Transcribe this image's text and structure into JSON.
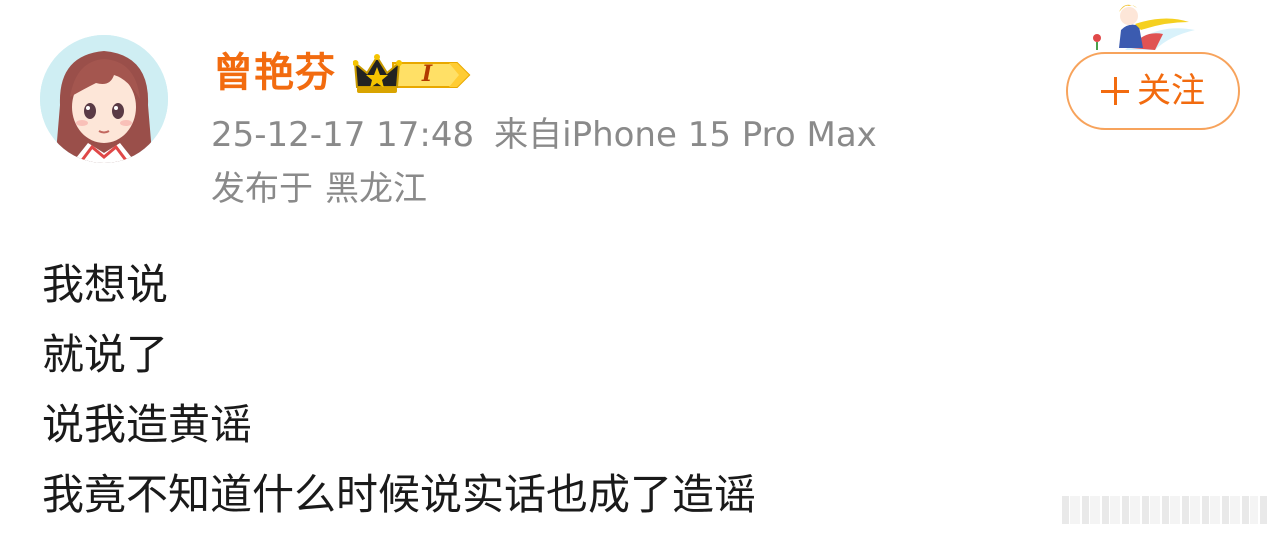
{
  "user": {
    "name": "曾艳芬",
    "vip_level": "I"
  },
  "post_meta": {
    "time": "25-12-17 17:48",
    "source": "来自iPhone 15 Pro Max",
    "location_prefix": "发布于",
    "location": "黑龙江"
  },
  "actions": {
    "follow_label": "关注"
  },
  "content": {
    "lines": [
      "我想说",
      "就说了",
      "说我造黄谣",
      "我竟不知道什么时候说实话也成了造谣"
    ]
  },
  "colors": {
    "username": "#f26b0f",
    "follow_border": "#f7a35c",
    "meta_text": "#8a8a8a",
    "body_text": "#1a1a1a"
  },
  "icons": {
    "avatar": "anime-girl-avatar",
    "vip": "crown-vip-badge",
    "deco": "little-prince-decoration",
    "watermark": "watermark-bars"
  }
}
